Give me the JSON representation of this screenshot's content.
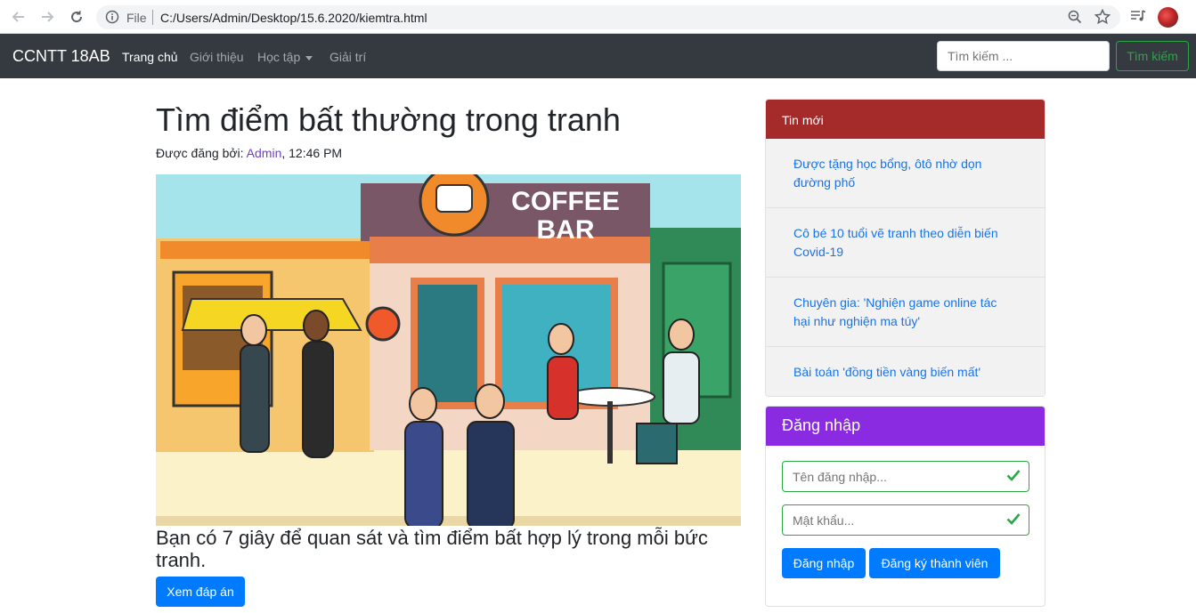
{
  "browser": {
    "file_label": "File",
    "url": "C:/Users/Admin/Desktop/15.6.2020/kiemtra.html"
  },
  "navbar": {
    "brand": "CCNTT 18AB",
    "links": [
      {
        "label": "Trang chủ"
      },
      {
        "label": "Giới thiệu"
      },
      {
        "label": "Học tập"
      },
      {
        "label": "Giải trí"
      }
    ],
    "search_placeholder": "Tìm kiếm ...",
    "search_button": "Tìm kiếm"
  },
  "article": {
    "title": "Tìm điểm bất thường trong tranh",
    "posted_by_prefix": "Được đăng bởi: ",
    "author": "Admin",
    "time": ", 12:46 PM",
    "image_sign": "COFFEE BAR",
    "subtitle": "Bạn có 7 giây để quan sát và tìm điểm bất hợp lý trong mỗi bức tranh.",
    "answer_button": "Xem đáp án"
  },
  "news": {
    "heading": "Tin mới",
    "items": [
      "Được tặng học bổng, ôtô nhờ dọn đường phố",
      "Cô bé 10 tuổi vẽ tranh theo diễn biến Covid-19",
      "Chuyên gia: 'Nghiện game online tác hại như nghiện ma túy'",
      "Bài toán 'đồng tiền vàng biến mất'"
    ]
  },
  "login": {
    "heading": "Đăng nhập",
    "username_placeholder": "Tên đăng nhập...",
    "password_placeholder": "Mật khẩu...",
    "login_button": "Đăng nhập",
    "register_button": "Đăng ký thành viên"
  },
  "colors": {
    "navbar": "#343a40",
    "news_header": "#a52a2a",
    "login_header": "#8a2be2",
    "primary": "#007bff",
    "success": "#28a745"
  }
}
